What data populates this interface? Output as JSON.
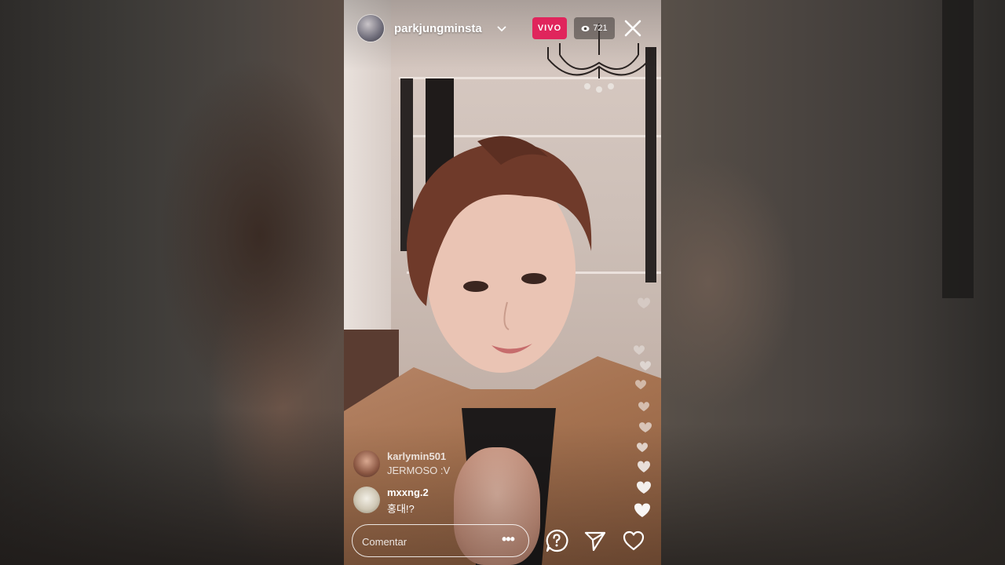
{
  "stream": {
    "username": "parkjungminsta",
    "live_label": "VIVO",
    "viewer_count": "721"
  },
  "comments": [
    {
      "user": "karlymin501",
      "text": "JERMOSO :V",
      "faded": true
    },
    {
      "user": "mxxng.2",
      "text": "홍대!?",
      "faded": false
    }
  ],
  "composer": {
    "placeholder": "Comentar"
  },
  "icons": {
    "chevron": "chevron-down-icon",
    "viewers": "eye-icon",
    "close": "close-icon",
    "more": "more-dots-icon",
    "question": "question-icon",
    "share": "send-icon",
    "like": "heart-icon"
  },
  "colors": {
    "live_badge": "#e0255c"
  }
}
